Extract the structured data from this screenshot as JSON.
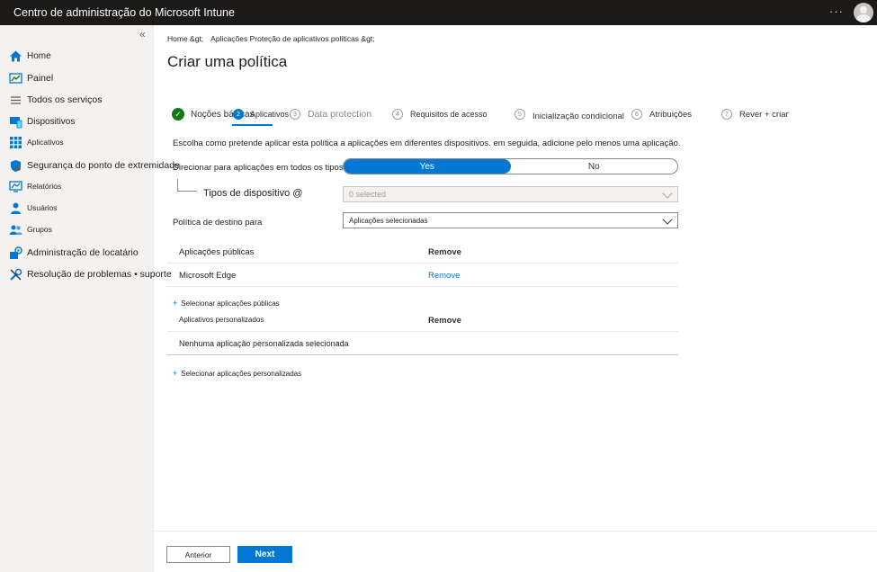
{
  "header": {
    "app_title": "Centro de administração do Microsoft Intune",
    "more": "···"
  },
  "sidebar": {
    "collapse": "«",
    "items": [
      {
        "label": "Home",
        "icon": "home-icon",
        "color": "#0078d4"
      },
      {
        "label": "Painel",
        "icon": "dashboard-icon",
        "color": "#0078d4"
      },
      {
        "label": "Todos os serviços",
        "icon": "list-icon",
        "color": "#605e5c"
      },
      {
        "label": "Dispositivos",
        "icon": "devices-icon",
        "color": "#0078d4"
      },
      {
        "label": "Aplicativos",
        "icon": "apps-grid-icon",
        "color": "#0078d4"
      },
      {
        "label": "Segurança do ponto de extremidade",
        "icon": "shield-icon",
        "color": "#0078d4"
      },
      {
        "label": "Relatórios",
        "icon": "reports-icon",
        "color": "#0078d4"
      },
      {
        "label": "Usuários",
        "icon": "user-icon",
        "color": "#0078d4"
      },
      {
        "label": "Grupos",
        "icon": "groups-icon",
        "color": "#0078d4"
      },
      {
        "label": "Administração de locatário",
        "icon": "tenant-icon",
        "color": "#0078d4"
      },
      {
        "label": "Resolução de problemas • suporte",
        "icon": "wrench-icon",
        "color": "#0078d4"
      }
    ]
  },
  "breadcrumb": {
    "home": "Home &gt;",
    "path": "Aplicações Proteção de aplicativos políticas &gt;"
  },
  "page_title": "Criar uma política",
  "wizard": {
    "steps": [
      {
        "num": "✓",
        "label": "Noções básicas",
        "state": "done"
      },
      {
        "num": "2",
        "label": "Aplicativos",
        "state": "current"
      },
      {
        "num": "3",
        "label": "Data protection",
        "state": "pending"
      },
      {
        "num": "4",
        "label": "Requisitos de acesso",
        "state": "pending"
      },
      {
        "num": "5",
        "label": "Inicialização condicional",
        "state": "pending"
      },
      {
        "num": "6",
        "label": "Atribuições",
        "state": "pending"
      },
      {
        "num": "7",
        "label": "Rever + criar",
        "state": "pending"
      }
    ]
  },
  "instructions": "Escolha como pretende aplicar esta política a aplicações em diferentes dispositivos. em seguida, adicione pelo menos uma aplicação.",
  "form": {
    "target_all_label": "Direcionar para aplicações em todos os tipos de dispositivos",
    "toggle_yes": "Yes",
    "toggle_no": "No",
    "device_types_label": "Tipos de dispositivo @",
    "device_types_value": "0 selected",
    "target_policy_label": "Política de destino para",
    "target_policy_value": "Aplicações selecionadas"
  },
  "public_apps": {
    "header": "Aplicações públicas",
    "header_action": "Remove",
    "rows": [
      {
        "name": "Microsoft Edge",
        "action": "Remove"
      }
    ],
    "add_link": "Selecionar  aplicações públicas"
  },
  "custom_apps": {
    "header": "Aplicativos  personalizados",
    "header_action": "Remove",
    "empty": "Nenhuma aplicação personalizada selecionada",
    "add_link": "Selecionar  aplicações personalizadas"
  },
  "footer": {
    "previous": "Anterior",
    "next": "Next"
  }
}
